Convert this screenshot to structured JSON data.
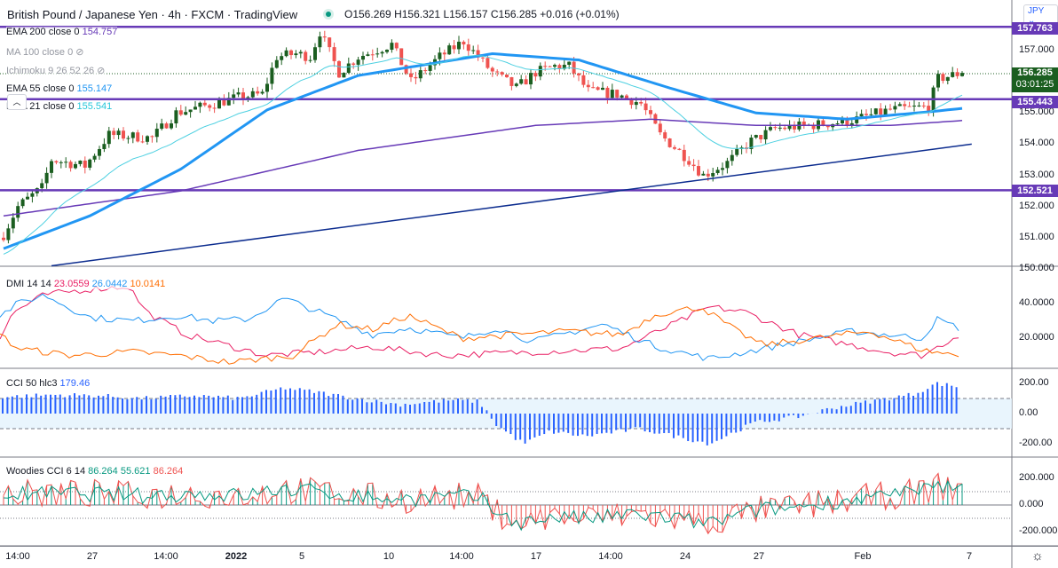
{
  "header": {
    "title": "British Pound / Japanese Yen · 4h · FXCM · TradingView",
    "open": "O156.269",
    "high": "H156.321",
    "low": "L156.157",
    "close": "C156.285",
    "change": "+0.016 (+0.01%)"
  },
  "legend": {
    "ema200": {
      "label": "EMA 200 close 0",
      "value": "154.757"
    },
    "ma100": {
      "label": "MA 100 close 0"
    },
    "ichimoku": {
      "label": "Ichimoku 9 26 52 26"
    },
    "ema55": {
      "label": "EMA 55 close 0",
      "value": "155.147"
    },
    "ema21": {
      "label": "EMA 21 close 0",
      "value": "155.541"
    },
    "dmi": {
      "label": "DMI 14 14",
      "adx": "23.0559",
      "plus": "26.0442",
      "minus": "10.0141"
    },
    "cci": {
      "label": "CCI 50 hlc3",
      "value": "179.46"
    },
    "woodies": {
      "label": "Woodies CCI 6 14",
      "v1": "86.264",
      "v2": "55.621",
      "v3": "86.264"
    }
  },
  "currency": "JPY",
  "price_axis": {
    "ticks": [
      "157.000",
      "155.000",
      "154.000",
      "153.000",
      "152.000",
      "151.000",
      "150.000"
    ],
    "levels": [
      {
        "label": "157.763"
      },
      {
        "label": "155.443"
      },
      {
        "label": "152.521"
      }
    ],
    "last_price": "156.285",
    "countdown": "03:01:25"
  },
  "dmi_axis": [
    "40.0000",
    "20.0000"
  ],
  "cci_axis": [
    "200.00",
    "0.00",
    "-200.00"
  ],
  "woodies_axis": [
    "200.000",
    "0.000",
    "-200.000"
  ],
  "time_axis": [
    "14:00",
    "27",
    "14:00",
    "2022",
    "5",
    "10",
    "14:00",
    "17",
    "14:00",
    "24",
    "27",
    "Feb",
    "7"
  ],
  "colors": {
    "up": "#1b5e20",
    "down": "#ef5350",
    "ema21": "#4dd0e1",
    "ema55": "#2196f3",
    "ema200": "#673ab7",
    "level": "#673ab7",
    "trend": "#0d2d8f",
    "adx": "#e91e63",
    "plus_di": "#2196f3",
    "minus_di": "#ff6d00",
    "cci": "#2962ff",
    "last": "#1b5e20"
  },
  "chart_data": {
    "type": "candlestick",
    "title": "British Pound / Japanese Yen 4h",
    "ylim": [
      150,
      158
    ],
    "close_path": [
      [
        0,
        151.1
      ],
      [
        3,
        152.0
      ],
      [
        8,
        152.6
      ],
      [
        10,
        153.5
      ],
      [
        17,
        153.3
      ],
      [
        22,
        154.3
      ],
      [
        31,
        154.2
      ],
      [
        36,
        155.0
      ],
      [
        44,
        155.3
      ],
      [
        49,
        155.5
      ],
      [
        54,
        155.6
      ],
      [
        57,
        156.8
      ],
      [
        61,
        156.9
      ],
      [
        64,
        156.8
      ],
      [
        66,
        157.6
      ],
      [
        70,
        156.3
      ],
      [
        74,
        156.8
      ],
      [
        81,
        157.2
      ],
      [
        85,
        156.0
      ],
      [
        91,
        156.8
      ],
      [
        96,
        157.3
      ],
      [
        102,
        156.3
      ],
      [
        107,
        155.8
      ],
      [
        111,
        156.3
      ],
      [
        115,
        156.5
      ],
      [
        118,
        156.5
      ],
      [
        122,
        155.7
      ],
      [
        128,
        155.6
      ],
      [
        133,
        155.3
      ],
      [
        137,
        154.3
      ],
      [
        143,
        153.5
      ],
      [
        146,
        153.0
      ],
      [
        151,
        153.4
      ],
      [
        156,
        154.1
      ],
      [
        161,
        154.5
      ],
      [
        168,
        154.6
      ],
      [
        174,
        154.7
      ],
      [
        178,
        154.8
      ],
      [
        185,
        155.1
      ],
      [
        193,
        155.2
      ],
      [
        195,
        156.1
      ],
      [
        200,
        156.285
      ]
    ],
    "ema55_path": [
      [
        0,
        150.65
      ],
      [
        18,
        151.7
      ],
      [
        37,
        153.2
      ],
      [
        55,
        155.1
      ],
      [
        74,
        156.2
      ],
      [
        102,
        156.9
      ],
      [
        120,
        156.7
      ],
      [
        139,
        155.8
      ],
      [
        157,
        155.0
      ],
      [
        176,
        154.8
      ],
      [
        194,
        155.05
      ],
      [
        200,
        155.147
      ]
    ],
    "ema200_path": [
      [
        0,
        151.7
      ],
      [
        37,
        152.5
      ],
      [
        74,
        153.8
      ],
      [
        111,
        154.6
      ],
      [
        135,
        154.8
      ],
      [
        157,
        154.6
      ],
      [
        185,
        154.6
      ],
      [
        200,
        154.757
      ]
    ],
    "trendline": [
      [
        10,
        150.1
      ],
      [
        202,
        154.0
      ]
    ],
    "levels": [
      157.763,
      155.443,
      152.521
    ],
    "dmi": {
      "adx_path": [
        [
          0,
          20
        ],
        [
          15,
          35
        ],
        [
          50,
          45
        ],
        [
          95,
          48
        ],
        [
          145,
          50
        ],
        [
          165,
          35
        ],
        [
          210,
          22
        ],
        [
          300,
          10
        ],
        [
          360,
          12
        ],
        [
          420,
          15
        ],
        [
          500,
          10
        ],
        [
          600,
          12
        ],
        [
          700,
          14
        ],
        [
          800,
          38
        ],
        [
          840,
          35
        ],
        [
          900,
          22
        ],
        [
          1000,
          12
        ],
        [
          1040,
          10
        ],
        [
          1080,
          22
        ]
      ],
      "plus_path": [
        [
          0,
          33
        ],
        [
          20,
          40
        ],
        [
          50,
          45
        ],
        [
          100,
          32
        ],
        [
          150,
          30
        ],
        [
          200,
          33
        ],
        [
          240,
          30
        ],
        [
          280,
          31
        ],
        [
          320,
          43
        ],
        [
          360,
          35
        ],
        [
          420,
          22
        ],
        [
          460,
          26
        ],
        [
          520,
          20
        ],
        [
          560,
          26
        ],
        [
          600,
          18
        ],
        [
          680,
          28
        ],
        [
          740,
          15
        ],
        [
          800,
          8
        ],
        [
          860,
          14
        ],
        [
          920,
          20
        ],
        [
          960,
          24
        ],
        [
          1000,
          22
        ],
        [
          1040,
          20
        ],
        [
          1055,
          31
        ],
        [
          1080,
          26
        ]
      ],
      "minus_path": [
        [
          0,
          22
        ],
        [
          20,
          14
        ],
        [
          80,
          10
        ],
        [
          150,
          12
        ],
        [
          200,
          10
        ],
        [
          260,
          6
        ],
        [
          330,
          10
        ],
        [
          380,
          28
        ],
        [
          420,
          25
        ],
        [
          460,
          33
        ],
        [
          520,
          20
        ],
        [
          580,
          22
        ],
        [
          640,
          24
        ],
        [
          700,
          22
        ],
        [
          740,
          34
        ],
        [
          790,
          38
        ],
        [
          830,
          24
        ],
        [
          860,
          16
        ],
        [
          920,
          20
        ],
        [
          980,
          24
        ],
        [
          1040,
          13
        ],
        [
          1080,
          10
        ]
      ]
    },
    "cci_path": [
      [
        0,
        110
      ],
      [
        60,
        125
      ],
      [
        110,
        120
      ],
      [
        160,
        100
      ],
      [
        220,
        120
      ],
      [
        270,
        100
      ],
      [
        320,
        170
      ],
      [
        360,
        140
      ],
      [
        400,
        100
      ],
      [
        450,
        60
      ],
      [
        510,
        90
      ],
      [
        540,
        80
      ],
      [
        560,
        -80
      ],
      [
        590,
        -200
      ],
      [
        620,
        -120
      ],
      [
        660,
        -150
      ],
      [
        720,
        -100
      ],
      [
        760,
        -150
      ],
      [
        800,
        -200
      ],
      [
        850,
        -60
      ],
      [
        900,
        -20
      ],
      [
        940,
        40
      ],
      [
        1000,
        100
      ],
      [
        1030,
        130
      ],
      [
        1055,
        200
      ],
      [
        1080,
        179
      ]
    ]
  }
}
